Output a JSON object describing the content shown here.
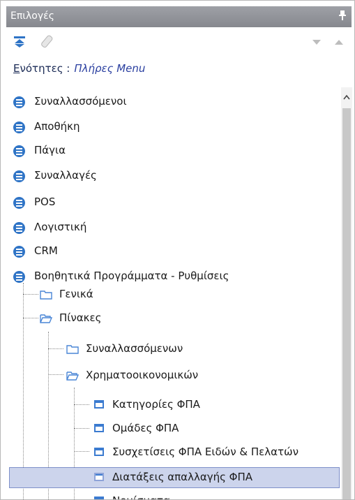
{
  "panel": {
    "title": "Επιλογές",
    "pin_glyph": "ᵖ"
  },
  "toolbar": {
    "icons": [
      "collapse-all-icon",
      "eraser-icon",
      "arrow-down-icon",
      "arrow-up-icon"
    ]
  },
  "sections": {
    "label_first": "Ε",
    "label_rest": "νότητες :",
    "value": "Πλήρες Menu"
  },
  "tree": {
    "top_items": [
      "Συναλλασσόμενοι",
      "Αποθήκη",
      "Πάγια",
      "Συναλλαγές",
      "POS",
      "Λογιστική",
      "CRM",
      "Βοηθητικά Προγράμματα - Ρυθμίσεις"
    ],
    "level1": [
      "Γενικά",
      "Πίνακες"
    ],
    "level2": [
      "Συναλλασσόμενων",
      "Χρηματοοικονομικών"
    ],
    "level3": [
      "Κατηγορίες ΦΠΑ",
      "Ομάδες ΦΠΑ",
      "Συσχετίσεις ΦΠΑ Ειδών & Πελατών",
      "Διατάξεις απαλλαγής ΦΠΑ",
      "Νομίσματα"
    ],
    "selected": "Διατάξεις απαλλαγής ΦΠΑ"
  },
  "colors": {
    "accent": "#2f74c6",
    "selection": "#ccd4ec",
    "titlebar": "#8f9197"
  }
}
